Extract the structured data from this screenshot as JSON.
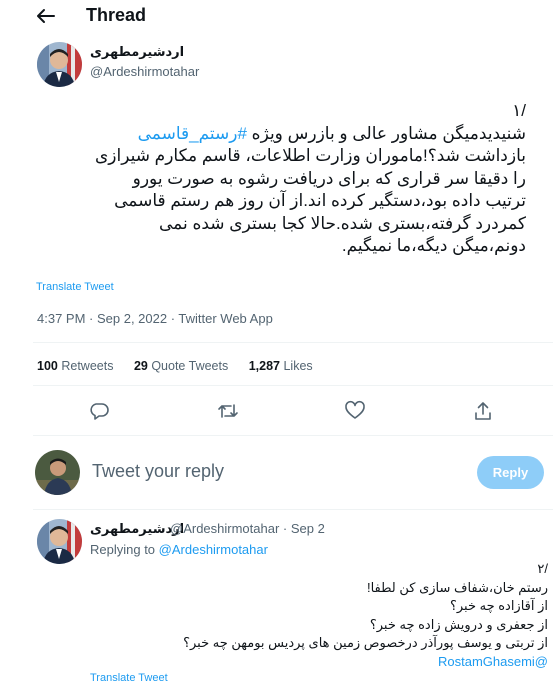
{
  "header": {
    "title": "Thread"
  },
  "tweet": {
    "author_name": "اردشیرمطهری",
    "author_handle": "@Ardeshirmotahar",
    "text_lines": [
      {
        "text": "/۱",
        "hashtag": ""
      },
      {
        "text": "شنیدیدمیگن مشاور عالی و بازرس ویژه ",
        "hashtag": "#رستم_قاسمی"
      },
      {
        "text": "بازداشت شد؟!ماموران وزارت اطلاعات، قاسم مکارم شیرازی",
        "hashtag": ""
      },
      {
        "text": "را دقیقا سر قراری که برای دریافت رشوه به صورت یورو",
        "hashtag": ""
      },
      {
        "text": "ترتیب داده بود،دستگیر کرده اند.از آن روز هم رستم قاسمی",
        "hashtag": ""
      },
      {
        "text": "کمردرد گرفته،بستری شده.حالا کجا بستری شده نمی",
        "hashtag": ""
      },
      {
        "text": "دونم،میگن دیگه،ما نمیگیم.",
        "hashtag": ""
      }
    ],
    "translate_label": "Translate Tweet",
    "meta": "4:37 PM · Sep 2, 2022 · Twitter Web App",
    "stats": [
      {
        "count": "100",
        "label": "Retweets"
      },
      {
        "count": "29",
        "label": "Quote Tweets"
      },
      {
        "count": "1,287",
        "label": "Likes"
      }
    ],
    "actions": [
      "reply-icon",
      "retweet-icon",
      "like-icon",
      "share-icon"
    ]
  },
  "compose": {
    "placeholder": "Tweet your reply",
    "button_label": "Reply"
  },
  "reply_tweet": {
    "author_name": "اردشیرمطهری",
    "handle_time": "@Ardeshirmotahar · Sep 2",
    "replying_prefix": "Replying to ",
    "replying_to": "@Ardeshirmotahar",
    "lines": [
      "/۲",
      "رستم خان،شفاف سازی کن لطفا!",
      "از آقازاده چه خبر؟",
      "از جعفری و درویش زاده چه خبر؟",
      "از تربتی و یوسف پورآذر درخصوص زمین های پردیس بومهن چه خبر؟"
    ],
    "mention": "@RostamGhasemi",
    "translate_label": "Translate Tweet"
  },
  "colors": {
    "accent": "#1d9bf0",
    "reply_button": "#8ecdf8",
    "muted": "#536471"
  }
}
